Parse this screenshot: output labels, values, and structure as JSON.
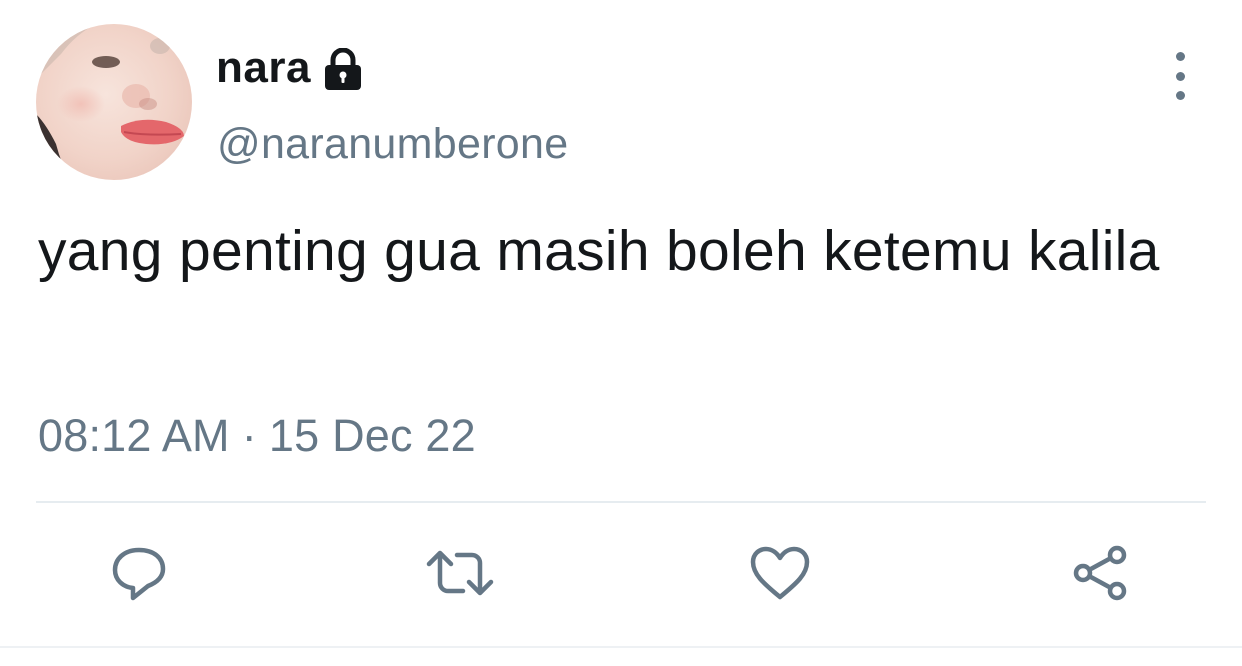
{
  "user": {
    "display_name": "nara",
    "handle": "@naranumberone",
    "protected": true,
    "lock_icon": "lock-icon",
    "avatar": "profile-photo"
  },
  "tweet": {
    "text": "yang penting gua masih boleh ketemu kalila",
    "time": "08:12 AM",
    "separator": "·",
    "date": "15 Dec 22"
  },
  "actions": [
    {
      "name": "reply",
      "icon": "reply-icon"
    },
    {
      "name": "retweet",
      "icon": "retweet-icon"
    },
    {
      "name": "like",
      "icon": "heart-icon"
    },
    {
      "name": "share",
      "icon": "share-icon"
    }
  ],
  "menu": {
    "icon": "more-vertical-icon"
  },
  "colors": {
    "text_primary": "#14171a",
    "text_secondary": "#657786",
    "divider": "#e6ecf0",
    "icon": "#657786"
  }
}
